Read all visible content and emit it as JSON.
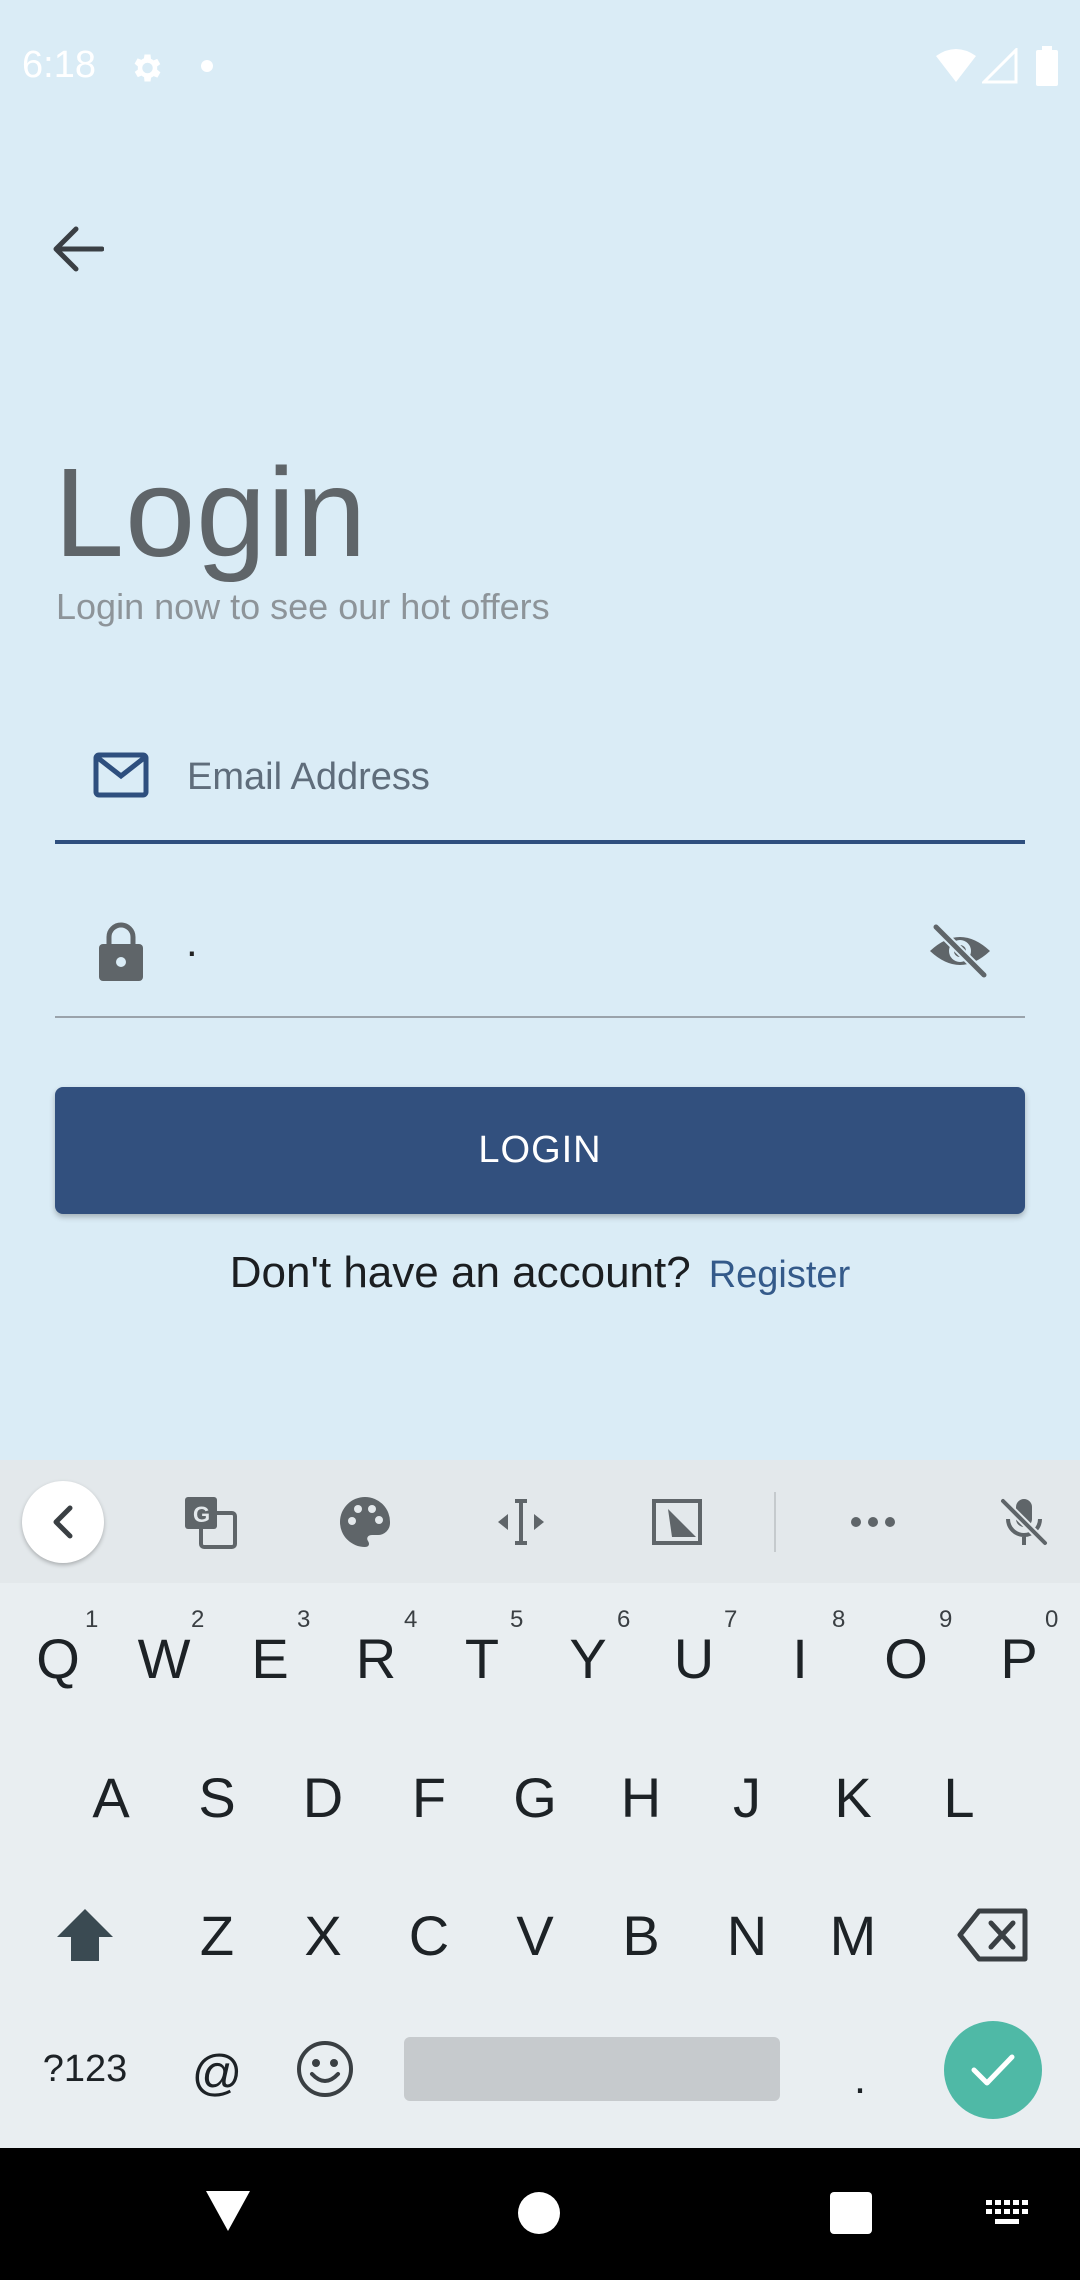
{
  "status_bar": {
    "time": "6:18"
  },
  "page": {
    "title": "Login",
    "subtitle": "Login now to see our hot offers"
  },
  "form": {
    "email_placeholder": "Email Address",
    "email_value": "",
    "password_value": "."
  },
  "actions": {
    "login_label": "LOGIN",
    "no_account_text": "Don't have an account?",
    "register_label": "Register"
  },
  "keyboard": {
    "row1": [
      "Q",
      "W",
      "E",
      "R",
      "T",
      "Y",
      "U",
      "I",
      "O",
      "P"
    ],
    "row1_hints": [
      "1",
      "2",
      "3",
      "4",
      "5",
      "6",
      "7",
      "8",
      "9",
      "0"
    ],
    "row2": [
      "A",
      "S",
      "D",
      "F",
      "G",
      "H",
      "J",
      "K",
      "L"
    ],
    "row3": [
      "Z",
      "X",
      "C",
      "V",
      "B",
      "N",
      "M"
    ],
    "symbols_label": "?123",
    "at_label": "@",
    "period_label": "."
  },
  "colors": {
    "background": "#daecf6",
    "primary": "#32507e",
    "enter_key": "#4fb9a6"
  }
}
